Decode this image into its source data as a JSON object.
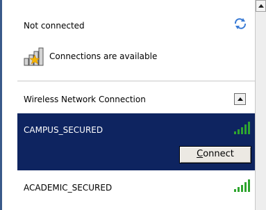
{
  "header": {
    "status_title": "Not connected",
    "refresh_icon": "refresh-icon"
  },
  "status": {
    "text": "Connections are available",
    "icon": "network-available-icon"
  },
  "section": {
    "title": "Wireless Network Connection",
    "collapse_icon": "collapse-up-icon"
  },
  "networks": [
    {
      "name": "CAMPUS_SECURED",
      "selected": true,
      "signal_bars": 5,
      "connect_prefix": "C",
      "connect_rest": "onnect"
    },
    {
      "name": "ACADEMIC_SECURED",
      "selected": false,
      "signal_bars": 5
    }
  ],
  "colors": {
    "selected_bg": "#0e2460",
    "signal_green": "#2fa52f",
    "warning_star": "#f5b400"
  }
}
